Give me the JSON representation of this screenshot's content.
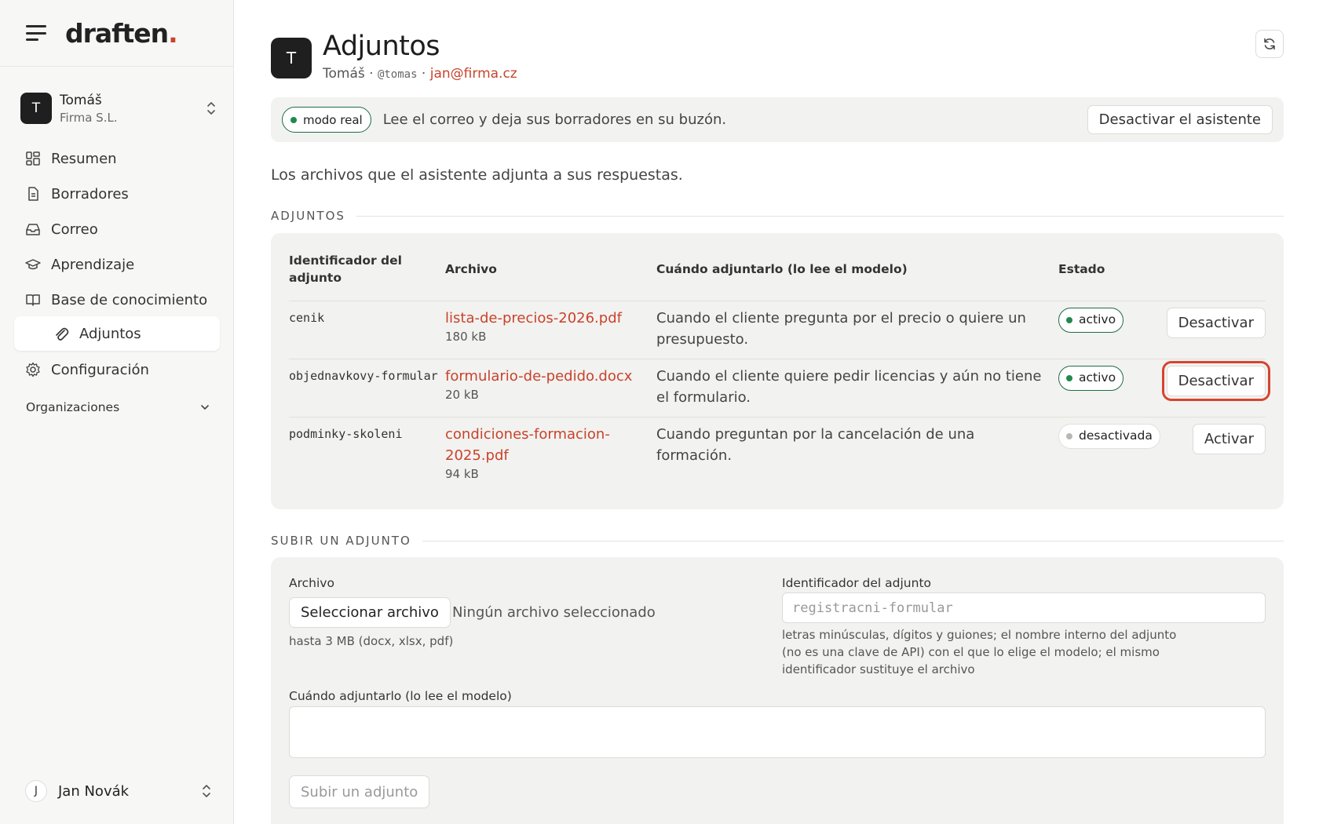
{
  "sidebar": {
    "brand": {
      "name": "draften",
      "dot": "."
    },
    "account": {
      "initial": "T",
      "name": "Tomáš",
      "org": "Firma S.L."
    },
    "nav": [
      {
        "label": "Resumen",
        "icon": "dashboard-icon"
      },
      {
        "label": "Borradores",
        "icon": "document-icon"
      },
      {
        "label": "Correo",
        "icon": "inbox-icon"
      },
      {
        "label": "Aprendizaje",
        "icon": "graduation-cap-icon"
      },
      {
        "label": "Base de conocimiento",
        "icon": "book-icon"
      },
      {
        "label": "Adjuntos",
        "icon": "paperclip-icon",
        "active": true
      },
      {
        "label": "Configuración",
        "icon": "gear-icon"
      }
    ],
    "organizations_label": "Organizaciones",
    "user": {
      "initial": "J",
      "name": "Jan Novák"
    }
  },
  "header": {
    "initial": "T",
    "title": "Adjuntos",
    "name": "Tomáš",
    "sep1": " · ",
    "handle": "@tomas",
    "sep2": " · ",
    "email": "jan@firma.cz"
  },
  "banner": {
    "mode": "modo real",
    "text": "Lee el correo y deja sus borradores en su buzón.",
    "button": "Desactivar el asistente"
  },
  "intro": "Los archivos que el asistente adjunta a sus respuestas.",
  "attachments": {
    "section_title": "ADJUNTOS",
    "columns": [
      "Identificador del adjunto",
      "Archivo",
      "Cuándo adjuntarlo (lo lee el modelo)",
      "Estado"
    ],
    "rows": [
      {
        "id": "cenik",
        "file": "lista-de-precios-2026.pdf",
        "size": "180 kB",
        "when": "Cuando el cliente pregunta por el precio o quiere un presupuesto.",
        "status": "activo",
        "action": "Desactivar"
      },
      {
        "id": "objednavkovy-formular",
        "file": "formulario-de-pedido.docx",
        "size": "20 kB",
        "when": "Cuando el cliente quiere pedir licencias y aún no tiene el formulario.",
        "status": "activo",
        "action": "Desactivar"
      },
      {
        "id": "podminky-skoleni",
        "file": "condiciones-formacion-2025.pdf",
        "size": "94 kB",
        "when": "Cuando preguntan por la cancelación de una formación.",
        "status": "desactivada",
        "action": "Activar"
      }
    ]
  },
  "upload": {
    "section_title": "SUBIR UN ADJUNTO",
    "file_label": "Archivo",
    "file_button": "Seleccionar archivo",
    "file_none": "Ningún archivo seleccionado",
    "file_hint": "hasta 3 MB (docx, xlsx, pdf)",
    "id_label": "Identificador del adjunto",
    "id_placeholder": "registracni-formular",
    "id_hint": "letras minúsculas, dígitos y guiones; el nombre interno del adjunto (no es una clave de API) con el que lo elige el modelo; el mismo identificador sustituye el archivo",
    "when_label": "Cuándo adjuntarlo (lo lee el modelo)",
    "submit": "Subir un adjunto"
  },
  "colors": {
    "accent": "#c8432c",
    "active_green": "#1f8a4c",
    "panel": "#f2f2f0"
  }
}
